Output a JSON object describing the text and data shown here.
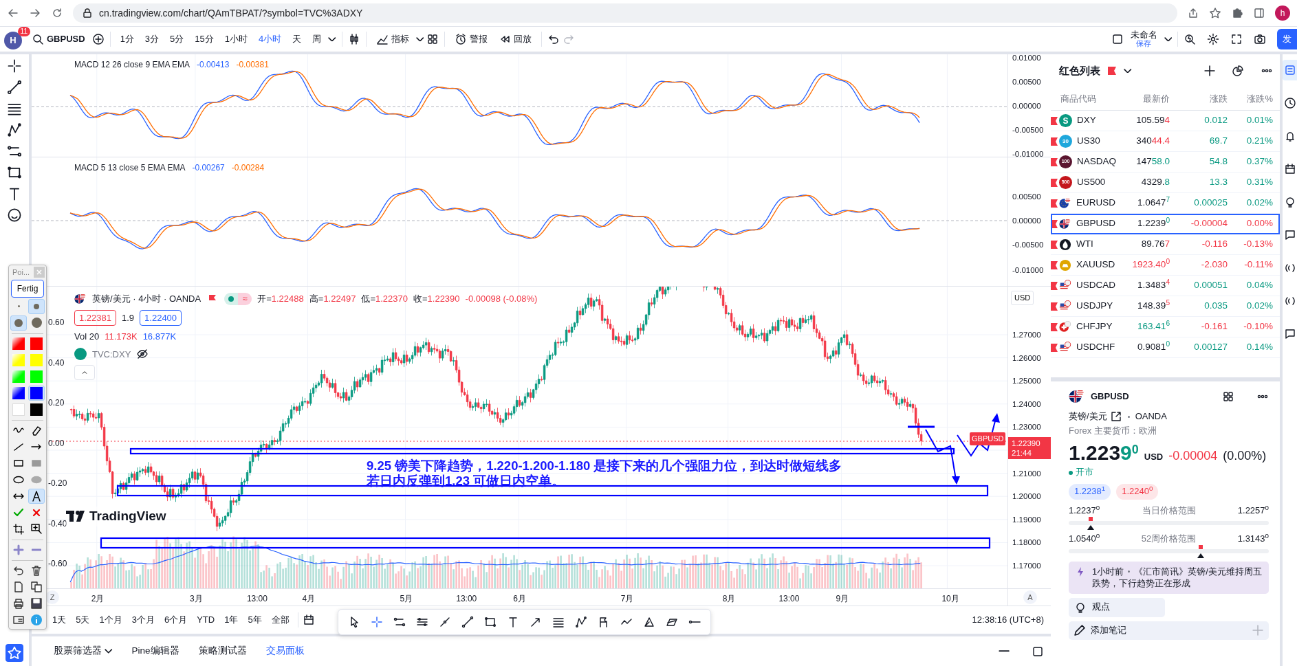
{
  "browser": {
    "url": "cn.tradingview.com/chart/QAmTBPAT/?symbol=TVC%3ADXY",
    "profile": "h"
  },
  "toolbar": {
    "avatar": "H",
    "notifications": "11",
    "symbol": "GBPUSD",
    "intervals": [
      {
        "label": "1分",
        "selected": false
      },
      {
        "label": "3分",
        "selected": false
      },
      {
        "label": "5分",
        "selected": false
      },
      {
        "label": "15分",
        "selected": false
      },
      {
        "label": "1小时",
        "selected": false
      },
      {
        "label": "4小时",
        "selected": true
      },
      {
        "label": "天",
        "selected": false
      },
      {
        "label": "周",
        "selected": false
      }
    ],
    "indicators": "指标",
    "alerts": "警报",
    "replay": "回放",
    "layout_name": "未命名",
    "save": "保存",
    "publish": "发"
  },
  "panes": [
    {
      "title": "MACD 12 26 close 9 EMA EMA",
      "values": [
        {
          "text": "-0.00413",
          "color": "#2962ff"
        },
        {
          "text": "-0.00381",
          "color": "#ff6d00"
        }
      ],
      "axis": [
        "0.01000",
        "0.00500",
        "0.00000",
        "-0.00500",
        "-0.01000"
      ]
    },
    {
      "title": "MACD 5 13 close 5 EMA EMA",
      "values": [
        {
          "text": "-0.00267",
          "color": "#2962ff"
        },
        {
          "text": "-0.00284",
          "color": "#ff6d00"
        }
      ],
      "axis": [
        "0.00500",
        "0.00000",
        "-0.00500",
        "-0.01000"
      ]
    }
  ],
  "main_chart": {
    "title": "英镑/美元 · 4小时 · OANDA",
    "status_symbol": "≈",
    "ohlc": [
      {
        "label": "开=",
        "value": "1.22488"
      },
      {
        "label": "高=",
        "value": "1.22497"
      },
      {
        "label": "低=",
        "value": "1.22370"
      },
      {
        "label": "收=",
        "value": "1.22390"
      }
    ],
    "change": "-0.00098 (-0.08%)",
    "bid": "1.22381",
    "spread": "1.9",
    "ask": "1.22400",
    "volume": {
      "title": "Vol 20",
      "values": [
        {
          "text": "11.173K",
          "color": "#f23645"
        },
        {
          "text": "16.877K",
          "color": "#2962ff"
        }
      ]
    },
    "overlay": "TVC:DXY",
    "currency": "USD",
    "axis": [
      {
        "kind": "tick",
        "text": "1.27000"
      },
      {
        "kind": "tick",
        "text": "1.26000"
      },
      {
        "kind": "tick",
        "text": "1.25000"
      },
      {
        "kind": "tick",
        "text": "1.24000"
      },
      {
        "kind": "tick",
        "text": "1.23000"
      },
      {
        "kind": "price_tag",
        "text": "1.22390",
        "time": "21:44"
      },
      {
        "kind": "tick",
        "text": "1.21000"
      },
      {
        "kind": "tick",
        "text": "1.20000"
      },
      {
        "kind": "tick",
        "text": "1.19000"
      },
      {
        "kind": "tick",
        "text": "1.18000"
      },
      {
        "kind": "tick",
        "text": "1.17000"
      }
    ],
    "left_axis": [
      "0.60",
      "0.40",
      "0.20",
      "0.00",
      "-0.20",
      "-0.40",
      "-0.60"
    ],
    "symbol_tag": "GBPUSD",
    "annotation": [
      "9.25 镑美下降趋势，1.220-1.200-1.180 是接下来的几个强阻力位，到达时做短线多",
      "若日内反弹到1.23 可做日内空单。"
    ],
    "logo": "TradingView"
  },
  "time_axis": {
    "start_button": "Z",
    "auto_button": "A",
    "labels": [
      "2月",
      "3月",
      "13:00",
      "4月",
      "5月",
      "13:00",
      "6月",
      "7月",
      "8月",
      "13:00",
      "9月",
      "10月"
    ]
  },
  "range_bar": {
    "ranges": [
      "1天",
      "5天",
      "1个月",
      "3个月",
      "6个月",
      "YTD",
      "1年",
      "5年",
      "全部"
    ],
    "clock": "12:38:16 (UTC+8)"
  },
  "drawing_toolbar": [
    {
      "kind": "cursor",
      "selected": false
    },
    {
      "kind": "cross",
      "selected": true
    },
    {
      "kind": "channel",
      "selected": false
    },
    {
      "kind": "multi_line",
      "selected": false
    },
    {
      "kind": "ray",
      "selected": false
    },
    {
      "kind": "line",
      "selected": false
    },
    {
      "kind": "rect",
      "selected": false
    },
    {
      "kind": "text",
      "selected": false
    },
    {
      "kind": "arrow",
      "selected": false
    },
    {
      "kind": "fib",
      "selected": false
    },
    {
      "kind": "pattern",
      "selected": false
    },
    {
      "kind": "flag",
      "selected": false
    },
    {
      "kind": "zigzag",
      "selected": false
    },
    {
      "kind": "triangle",
      "selected": false
    },
    {
      "kind": "parallelogram",
      "selected": false
    },
    {
      "kind": "hline",
      "selected": false
    }
  ],
  "bottom_tabs": [
    {
      "label": "股票筛选器",
      "dropdown": true,
      "selected": false
    },
    {
      "label": "Pine编辑器",
      "dropdown": false,
      "selected": false
    },
    {
      "label": "策略测试器",
      "dropdown": false,
      "selected": false
    },
    {
      "label": "交易面板",
      "dropdown": false,
      "selected": true
    }
  ],
  "palette": {
    "title": "Poi...",
    "done": "Fertig",
    "sizes": [
      {
        "selected": false
      },
      {
        "selected": true
      },
      {
        "selected": true
      },
      {
        "selected": false
      }
    ],
    "colors": [
      {
        "kind": "gradient",
        "color": "#ff0000",
        "selected": false
      },
      {
        "kind": "solid",
        "color": "#ff0000",
        "selected": false
      },
      {
        "kind": "gradient",
        "color": "#ffff00",
        "selected": false
      },
      {
        "kind": "solid",
        "color": "#ffff00",
        "selected": false
      },
      {
        "kind": "gradient",
        "color": "#00ff00",
        "selected": false
      },
      {
        "kind": "solid",
        "color": "#00ff00",
        "selected": false
      },
      {
        "kind": "gradient",
        "color": "#0000ff",
        "selected": false
      },
      {
        "kind": "solid",
        "color": "#0000ff",
        "selected": true
      },
      {
        "kind": "solid",
        "color": "#ffffff",
        "selected": false
      },
      {
        "kind": "solid",
        "color": "#000000",
        "selected": false
      }
    ],
    "tools": [
      {
        "kind": "freehand",
        "selected": false
      },
      {
        "kind": "eraser",
        "selected": false
      },
      {
        "kind": "line",
        "selected": false
      },
      {
        "kind": "arrow",
        "selected": false
      },
      {
        "kind": "rect",
        "selected": false
      },
      {
        "kind": "rect_fill",
        "selected": false
      },
      {
        "kind": "ellipse",
        "selected": false
      },
      {
        "kind": "ellipse_fill",
        "selected": false
      },
      {
        "kind": "double_arrow",
        "selected": false
      },
      {
        "kind": "text",
        "selected": true
      },
      {
        "kind": "check",
        "selected": false
      },
      {
        "kind": "cross",
        "selected": false
      },
      {
        "kind": "crop",
        "selected": false
      },
      {
        "kind": "zoom",
        "selected": false
      }
    ],
    "actions": [
      {
        "kind": "plus"
      },
      {
        "kind": "minus"
      },
      {
        "kind": "undo"
      },
      {
        "kind": "trash"
      },
      {
        "kind": "page"
      },
      {
        "kind": "copy"
      },
      {
        "kind": "print"
      },
      {
        "kind": "save"
      },
      {
        "kind": "card"
      },
      {
        "kind": "info"
      }
    ]
  },
  "watchlist": {
    "title": "红色列表",
    "columns": [
      "商品代码",
      "最新价",
      "涨跌",
      "涨跌%"
    ],
    "rows": [
      {
        "symbol": "DXY",
        "logo": {
          "kind": "letter",
          "text": "S",
          "color": "#089981"
        },
        "price": {
          "base": "105.59",
          "moved": "4"
        },
        "tick_up": false,
        "change": "0.012",
        "pct": "0.01%",
        "change_up": true,
        "selected": false
      },
      {
        "symbol": "US30",
        "logo": {
          "kind": "letter",
          "text": "30",
          "color": "#1ea7dc"
        },
        "price": {
          "base": "340",
          "moved": "44.4"
        },
        "tick_up": false,
        "change": "69.7",
        "pct": "0.21%",
        "change_up": true,
        "selected": false
      },
      {
        "symbol": "NASDAQ",
        "logo": {
          "kind": "letter",
          "text": "100",
          "color": "#5a1530"
        },
        "price": {
          "base": "147",
          "moved": "58.0"
        },
        "tick_up": true,
        "change": "54.8",
        "pct": "0.37%",
        "change_up": true,
        "selected": false
      },
      {
        "symbol": "US500",
        "logo": {
          "kind": "letter",
          "text": "500",
          "color": "#c4161c"
        },
        "price": {
          "base": "4329.",
          "moved": "8"
        },
        "tick_up": true,
        "change": "13.3",
        "pct": "0.31%",
        "change_up": true,
        "selected": false
      },
      {
        "symbol": "EURUSD",
        "logo": {
          "kind": "flag_eu"
        },
        "price": {
          "base": "1.0647",
          "pip": "7"
        },
        "tick_up": true,
        "change": "0.00025",
        "pct": "0.02%",
        "change_up": true,
        "selected": false
      },
      {
        "symbol": "GBPUSD",
        "logo": {
          "kind": "flag_gb"
        },
        "price": {
          "base": "1.2239",
          "pip": "0"
        },
        "tick_up": true,
        "change": "-0.00004",
        "pct": "0.00%",
        "change_up": false,
        "selected": true
      },
      {
        "symbol": "WTI",
        "logo": {
          "kind": "drop"
        },
        "price": {
          "base": "89.76",
          "moved": "7"
        },
        "tick_up": false,
        "change": "-0.116",
        "pct": "-0.13%",
        "change_up": false,
        "selected": false
      },
      {
        "symbol": "XAUUSD",
        "logo": {
          "kind": "gold"
        },
        "price": {
          "moved": "1923.40",
          "pip": "0"
        },
        "tick_up": false,
        "change": "-2.030",
        "pct": "-0.11%",
        "change_up": false,
        "selected": false
      },
      {
        "symbol": "USDCAD",
        "logo": {
          "kind": "flag_us"
        },
        "price": {
          "base": "1.3483",
          "pip": "4"
        },
        "tick_up": false,
        "change": "0.00051",
        "pct": "0.04%",
        "change_up": true,
        "selected": false
      },
      {
        "symbol": "USDJPY",
        "logo": {
          "kind": "flag_us"
        },
        "price": {
          "base": "148.39",
          "pip": "5"
        },
        "tick_up": false,
        "change": "0.035",
        "pct": "0.02%",
        "change_up": true,
        "selected": false
      },
      {
        "symbol": "CHFJPY",
        "logo": {
          "kind": "flag_ch"
        },
        "price": {
          "moved": "163.41",
          "pip": "6"
        },
        "tick_up": true,
        "change": "-0.161",
        "pct": "-0.10%",
        "change_up": false,
        "selected": false
      },
      {
        "symbol": "USDCHF",
        "logo": {
          "kind": "flag_us"
        },
        "price": {
          "base": "0.9081",
          "pip": "0"
        },
        "tick_up": true,
        "change": "0.00127",
        "pct": "0.14%",
        "change_up": true,
        "selected": false
      }
    ]
  },
  "details": {
    "symbol": "GBPUSD",
    "name": "英镑/美元",
    "exchange": "OANDA",
    "category": "Forex 主要货币：欧洲",
    "price": {
      "base": "1.223",
      "moved": "9",
      "pip": "0"
    },
    "currency": "USD",
    "change": "-0.00004",
    "pct": "(0.00%)",
    "change_up": false,
    "status": "开市",
    "bid": {
      "base": "1.2238",
      "pip": "1"
    },
    "ask": {
      "base": "1.2240",
      "pip": "0"
    },
    "ranges": [
      {
        "low": {
          "base": "1.2237",
          "pip": "0"
        },
        "label": "当日价格范围",
        "high": {
          "base": "1.2257",
          "pip": "0"
        },
        "level": 0.11
      },
      {
        "low": {
          "base": "1.0540",
          "pip": "0"
        },
        "label": "52周价格范围",
        "high": {
          "base": "1.3143",
          "pip": "0"
        },
        "level": 0.66
      }
    ],
    "news": {
      "time": "1小时前",
      "headline": "《汇市简讯》英镑/美元维持周五跌势，下行趋势正在形成"
    },
    "ideas": "观点",
    "note": "添加笔记"
  },
  "right_strip": [
    {
      "selected": true
    },
    {
      "selected": false
    },
    {
      "selected": false
    },
    {
      "selected": false
    },
    {
      "selected": false
    },
    {
      "selected": false
    },
    {
      "selected": false
    },
    {
      "selected": false
    },
    {
      "selected": false
    }
  ]
}
